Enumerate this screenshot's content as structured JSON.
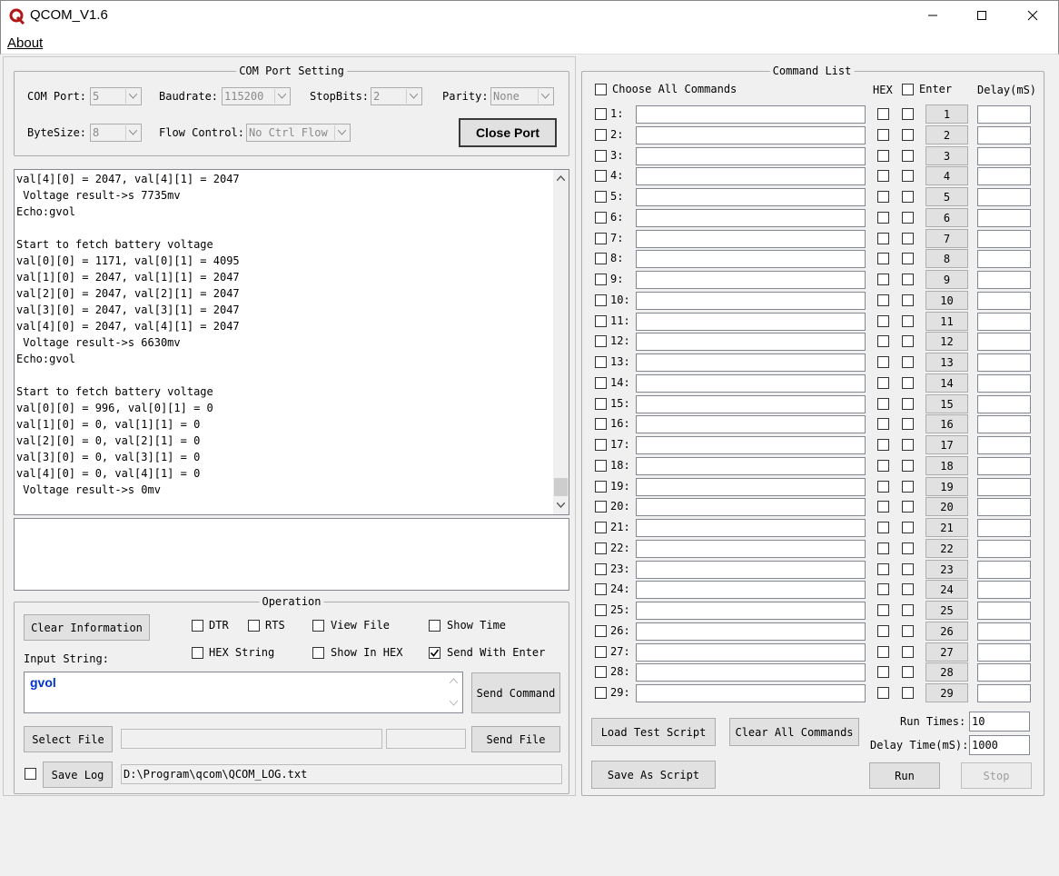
{
  "window": {
    "title": "QCOM_V1.6"
  },
  "menu": {
    "about": "About"
  },
  "com_port": {
    "title": "COM Port Setting",
    "com_port_label": "COM Port:",
    "com_port_value": "5",
    "baudrate_label": "Baudrate:",
    "baudrate_value": "115200",
    "stopbits_label": "StopBits:",
    "stopbits_value": "2",
    "parity_label": "Parity:",
    "parity_value": "None",
    "bytesize_label": "ByteSize:",
    "bytesize_value": "8",
    "flow_label": "Flow Control:",
    "flow_value": "No Ctrl Flow",
    "close_port": "Close Port"
  },
  "log": {
    "lines": [
      "val[4][0] = 2047, val[4][1] = 2047",
      " Voltage result->s 7735mv",
      "Echo:gvol",
      "",
      "Start to fetch battery voltage",
      "val[0][0] = 1171, val[0][1] = 4095",
      "val[1][0] = 2047, val[1][1] = 2047",
      "val[2][0] = 2047, val[2][1] = 2047",
      "val[3][0] = 2047, val[3][1] = 2047",
      "val[4][0] = 2047, val[4][1] = 2047",
      " Voltage result->s 6630mv",
      "Echo:gvol",
      "",
      "Start to fetch battery voltage",
      "val[0][0] = 996, val[0][1] = 0",
      "val[1][0] = 0, val[1][1] = 0",
      "val[2][0] = 0, val[2][1] = 0",
      "val[3][0] = 0, val[3][1] = 0",
      "val[4][0] = 0, val[4][1] = 0",
      " Voltage result->s 0mv"
    ]
  },
  "operation": {
    "title": "Operation",
    "clear_info": "Clear Information",
    "dtr": "DTR",
    "rts": "RTS",
    "view_file": "View File",
    "show_time": "Show Time",
    "hex_string": "HEX String",
    "show_in_hex": "Show In HEX",
    "send_with_enter": "Send With Enter",
    "input_label": "Input String:",
    "input_value": "gvol",
    "send_command": "Send Command",
    "select_file": "Select File",
    "send_file": "Send File",
    "save_log": "Save Log",
    "log_path": "D:\\Program\\qcom\\QCOM_LOG.txt"
  },
  "command_list": {
    "title": "Command List",
    "choose_all": "Choose All Commands",
    "hex_header": "HEX",
    "enter_header": "Enter",
    "delay_header": "Delay(mS)",
    "rows": [
      "1",
      "2",
      "3",
      "4",
      "5",
      "6",
      "7",
      "8",
      "9",
      "10",
      "11",
      "12",
      "13",
      "14",
      "15",
      "16",
      "17",
      "18",
      "19",
      "20",
      "21",
      "22",
      "23",
      "24",
      "25",
      "26",
      "27",
      "28",
      "29"
    ],
    "load_script": "Load Test Script",
    "clear_all": "Clear All Commands",
    "save_script": "Save As Script",
    "run_times_label": "Run Times:",
    "run_times_value": "10",
    "delay_time_label": "Delay Time(mS):",
    "delay_time_value": "1000",
    "run": "Run",
    "stop": "Stop"
  }
}
